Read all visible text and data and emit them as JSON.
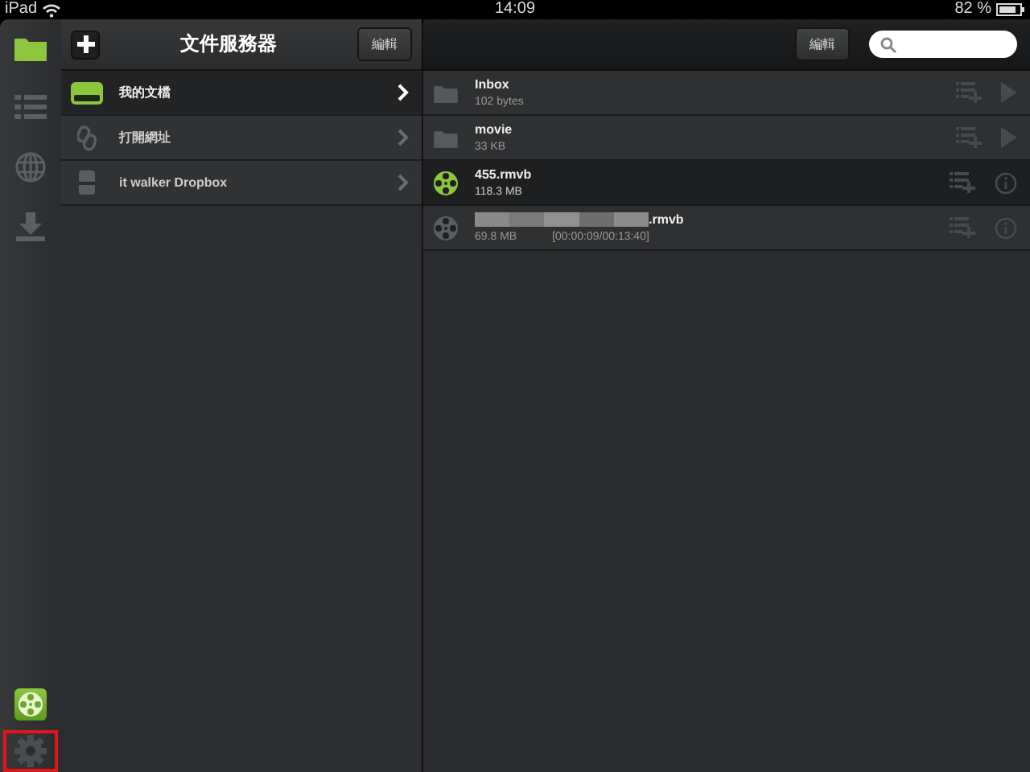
{
  "status_bar": {
    "device": "iPad",
    "time": "14:09",
    "battery": "82 %"
  },
  "rail": {
    "items": [
      {
        "kind": "folder",
        "selected": true
      },
      {
        "kind": "list",
        "selected": false
      },
      {
        "kind": "globe",
        "selected": false
      },
      {
        "kind": "download",
        "selected": false
      }
    ],
    "bottom": [
      {
        "kind": "film",
        "annotated": false
      },
      {
        "kind": "gear",
        "annotated": true
      }
    ]
  },
  "server_panel": {
    "title": "文件服務器",
    "edit": "編輯",
    "items": [
      {
        "kind": "drive",
        "label": "我的文檔",
        "selected": true
      },
      {
        "kind": "link",
        "label": "打開網址",
        "selected": false
      },
      {
        "kind": "dropbox",
        "label": "it walker Dropbox",
        "selected": false
      }
    ]
  },
  "files": {
    "edit": "編輯",
    "items": [
      {
        "kind": "folder",
        "name": "Inbox",
        "redacted": false,
        "size": "102 bytes",
        "selected": false
      },
      {
        "kind": "folder",
        "name": "movie",
        "redacted": false,
        "size": "33 KB",
        "selected": false
      },
      {
        "kind": "video",
        "name": "455.rmvb",
        "redacted": false,
        "size": "118.3 MB",
        "selected": true
      },
      {
        "kind": "video",
        "name": ".rmvb",
        "redacted": true,
        "size": "69.8 MB",
        "progress": "[00:00:09/00:13:40]",
        "selected": false
      }
    ]
  }
}
